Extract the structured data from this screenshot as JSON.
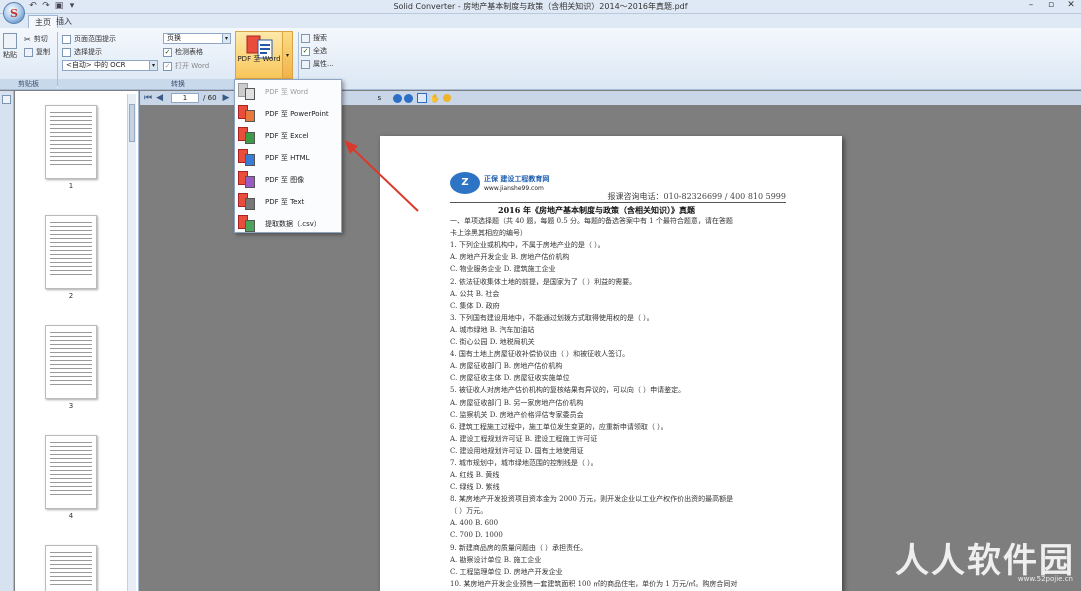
{
  "window": {
    "title": "Solid Converter - 房地产基本制度与政策（含相关知识）2014～2016年真题.pdf",
    "app_logo_letter": "S",
    "controls": [
      "–",
      "▫",
      "✕"
    ]
  },
  "tabs": [
    {
      "label": "主页"
    },
    {
      "label": "插入"
    }
  ],
  "ribbon": {
    "clipboard": {
      "paste": "粘贴",
      "cut": "剪切",
      "copy": "复制",
      "group_label": "剪贴板"
    },
    "convert": {
      "page_range": "页面范围提示",
      "select_hint": "选择提示",
      "ocr_select": "<自动> 中的 OCR",
      "layout_select": "页换",
      "detect_tables": "检测表格",
      "open_word": "打开 Word",
      "big_button": "PDF 至 Word",
      "group_label": "转换"
    },
    "find": {
      "search": "搜索",
      "select_all": "全选",
      "properties": "属性..."
    }
  },
  "toolbar": {
    "page_current": "1",
    "page_total": "/ 60",
    "zoom_suffix": "s"
  },
  "menu": {
    "items": [
      {
        "label": "PDF 至 Word",
        "disabled": true
      },
      {
        "label": "PDF 至 PowerPoint",
        "disabled": false
      },
      {
        "label": "PDF 至 Excel",
        "disabled": false
      },
      {
        "label": "PDF 至 HTML",
        "disabled": false
      },
      {
        "label": "PDF 至 图像",
        "disabled": false
      },
      {
        "label": "PDF 至 Text",
        "disabled": false
      },
      {
        "label": "提取数据（.csv）",
        "disabled": false
      }
    ]
  },
  "thumbnails": [
    {
      "number": "1"
    },
    {
      "number": "2"
    },
    {
      "number": "3"
    },
    {
      "number": "4"
    },
    {
      "number": ""
    }
  ],
  "document": {
    "logo_mark": "Z",
    "logo_name": "正保 建设工程教育网",
    "logo_url": "www.jianshe99.com",
    "hotline": "报课咨询电话：010-82326699 / 400 810 5999",
    "title": "2016 年《房地产基本制度与政策（含相关知识）》真题",
    "lines": [
      "一、单项选择题（共 40 题，每题 0.5 分。每题的备选答案中有 1 个最符合题意，请在答题",
      "卡上涂黑其相应的编号）",
      "1. 下列企业或机构中，不属于房地产业的是（    ）。",
      "A. 房地产开发企业      B. 房地产估价机构",
      "C. 物业服务企业        D. 建筑施工企业",
      "2. 依法征收集体土地的前提，是国家为了（    ）利益的需要。",
      "A. 公共    B. 社会",
      "C. 集体    D. 政府",
      "3. 下列国有建设用地中，不能通过划拨方式取得使用权的是（    ）。",
      "A. 城市绿地    B. 汽车加油站",
      "C. 街心公园    D. 地税局机关",
      "4. 国有土地上房屋征收补偿协议由（    ）和被征收人签订。",
      "A. 房屋征收部门    B. 房地产估价机构",
      "C. 房屋征收主体    D. 房屋征收实施单位",
      "5. 被征收人对房地产估价机构的复核结果有异议的，可以向（    ）申请鉴定。",
      "A. 房屋征收部门    B. 另一家房地产估价机构",
      "C. 监察机关        D. 房地产价格评估专家委员会",
      "6. 建筑工程施工过程中，施工单位发生变更的，应重新申请领取（    ）。",
      "A. 建设工程规划许可证    B. 建设工程施工许可证",
      "C. 建设用地规划许可证    D. 国有土地使用证",
      "7. 城市规划中，城市绿地范围的控制线是（    ）。",
      "A. 红线      B. 黄线",
      "C. 绿线      D. 紫线",
      "8. 某房地产开发投资项目资本金为 2000 万元，则开发企业以工业产权作价出资的最高额是",
      "（    ）万元。",
      "A. 400       B. 600",
      "C. 700       D. 1000",
      "9. 新建商品房的质量问题由（    ）承担责任。",
      "A. 勘察设计单位    B. 施工企业",
      "C. 工程监理单位    D. 房地产开发企业",
      "10. 某房地产开发企业预售一套建筑面积 100 ㎡的商品住宅，单价为 1 万元/㎡。购房合同对"
    ]
  },
  "watermark": {
    "text": "人人软件园",
    "url": "www.52pojie.cn"
  }
}
